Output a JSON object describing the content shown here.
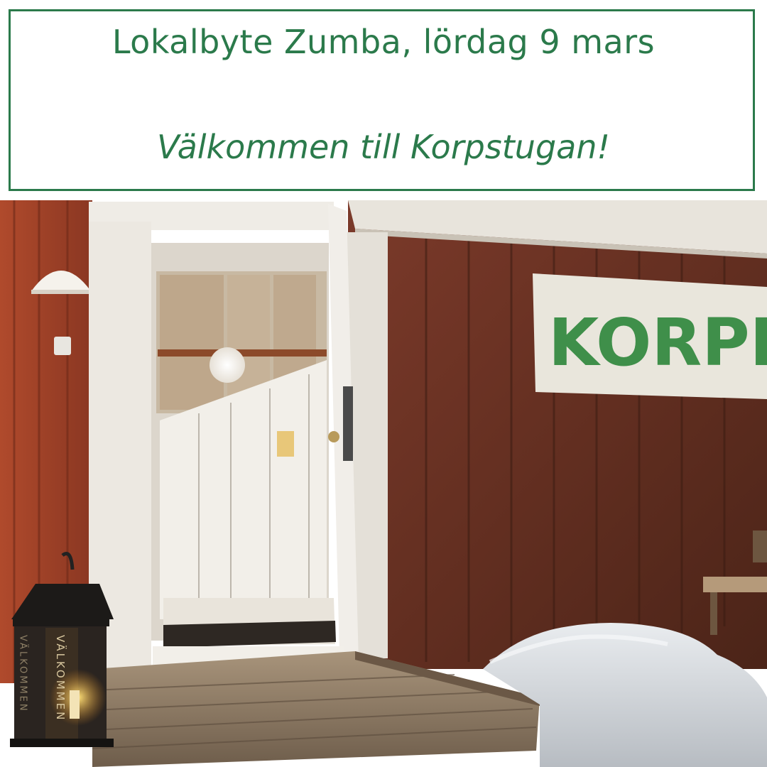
{
  "banner": {
    "headline": "Lokalbyte Zumba, lördag 9 mars",
    "welcome": "Välkommen till Korpstugan!"
  },
  "photo": {
    "sign_text": "KORPE",
    "lantern_left_text": "VÄLKOMMEN",
    "lantern_front_text": "VÄLKOMMEN"
  },
  "colors": {
    "accent": "#2b7a4b",
    "wall_red": "#8c3f2c",
    "sign_green": "#3f8f4a"
  }
}
